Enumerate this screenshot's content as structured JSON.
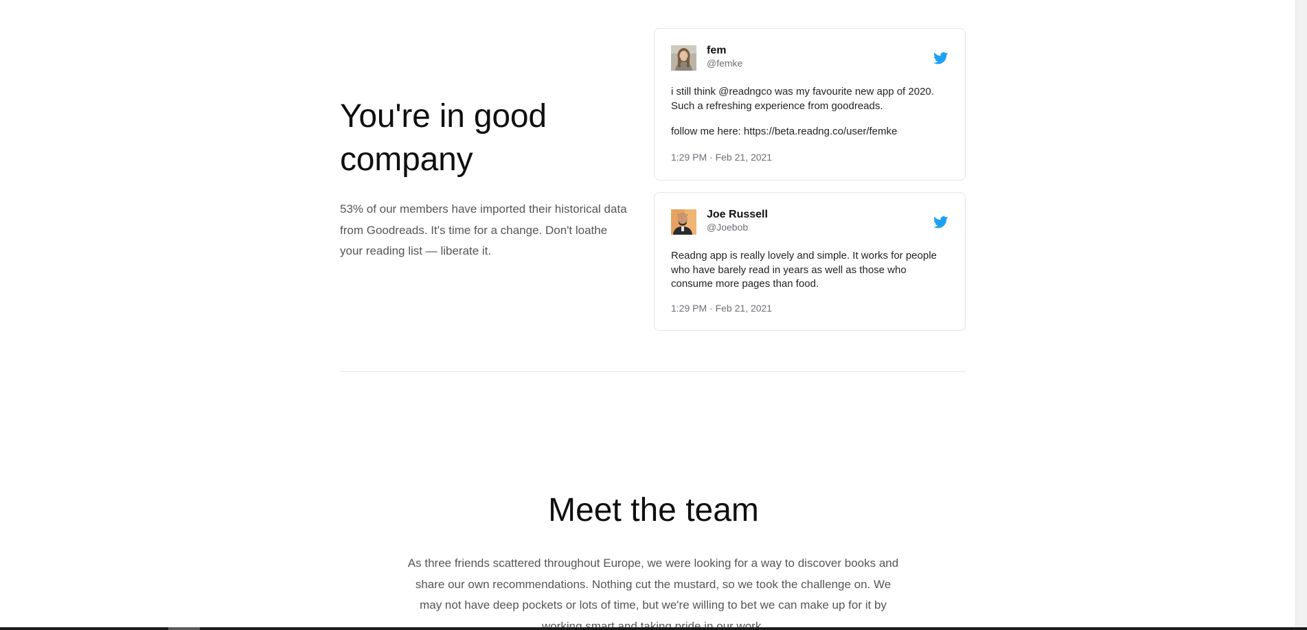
{
  "company": {
    "heading": "You're in good company",
    "description": "53% of our members have imported their historical data from Goodreads. It's time for a change. Don't loathe your reading list — liberate it."
  },
  "tweets": [
    {
      "name": "fem",
      "handle": "@femke",
      "paragraphs": [
        "i still think @readngco was my favourite new app of 2020. Such a refreshing experience from goodreads.",
        "follow me here: https://beta.readng.co/user/femke"
      ],
      "timestamp": "1:29 PM · Feb 21, 2021",
      "avatar_icon": "avatar-woman",
      "platform_icon": "twitter-icon"
    },
    {
      "name": "Joe Russell",
      "handle": "@Joebob",
      "paragraphs": [
        "Readng app is really lovely and simple. It works for people who have barely read in years as well as those who consume more pages than food."
      ],
      "timestamp": "1:29 PM · Feb 21, 2021",
      "avatar_icon": "avatar-man",
      "platform_icon": "twitter-icon"
    }
  ],
  "team": {
    "heading": "Meet the team",
    "description": "As three friends scattered throughout Europe, we were looking for a way to discover books and share our own recommendations. Nothing cut the mustard, so we took the challenge on. We may not have deep pockets or lots of time, but we're willing to bet we can make up for it by working smart and taking pride in our work."
  },
  "colors": {
    "twitter_blue": "#1da1f2",
    "heading": "#0f0f0f",
    "body_text": "#555555",
    "card_border": "#e3e6ea"
  }
}
